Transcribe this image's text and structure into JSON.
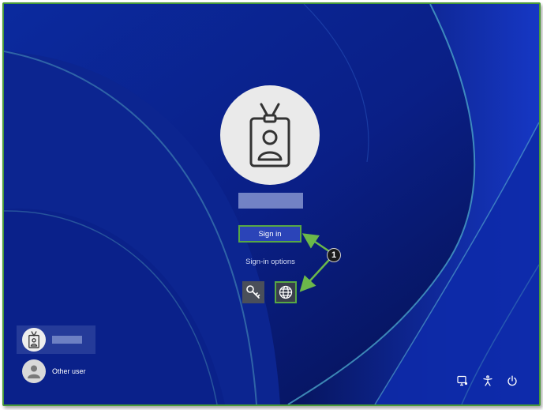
{
  "signin": {
    "button_label": "Sign in",
    "options_label": "Sign-in options"
  },
  "sign_in_options": [
    {
      "icon": "key-icon"
    },
    {
      "icon": "globe-icon"
    }
  ],
  "callout": {
    "number": "1"
  },
  "users": [
    {
      "icon": "badge-user-icon",
      "selected": true
    },
    {
      "icon": "person-icon",
      "label": "Other user"
    }
  ],
  "tray_icons": [
    "accessibility-display-icon",
    "accessibility-icon",
    "power-icon"
  ],
  "colors": {
    "highlight": "#57a844",
    "button": "#2b44b8",
    "background": "#0a1f8a"
  }
}
